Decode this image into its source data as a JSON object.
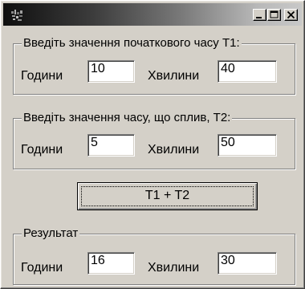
{
  "window": {
    "title": ""
  },
  "titlebar": {
    "minimize_label": "minimize",
    "maximize_label": "maximize",
    "close_label": "close"
  },
  "start_time": {
    "group_label": "Введіть значення початкового часу Т1:",
    "hours_label": "Години",
    "hours_value": "10",
    "minutes_label": "Хвилини",
    "minutes_value": "40"
  },
  "elapsed_time": {
    "group_label": "Введіть значення часу, що сплив, Т2:",
    "hours_label": "Години",
    "hours_value": "5",
    "minutes_label": "Хвилини",
    "minutes_value": "50"
  },
  "action": {
    "button_label": "T1 + T2"
  },
  "result": {
    "group_label": "Результат",
    "hours_label": "Години",
    "hours_value": "16",
    "minutes_label": "Хвилини",
    "minutes_value": "30"
  },
  "colors": {
    "face": "#d4d0c8",
    "shadow": "#808080",
    "highlight": "#ffffff",
    "titlebar_dark": "#0f0f0f",
    "titlebar_light": "#c8c8c8"
  },
  "icons": {
    "app": "app-icon",
    "minimize": "minimize-icon",
    "maximize": "maximize-icon",
    "close": "close-icon"
  }
}
